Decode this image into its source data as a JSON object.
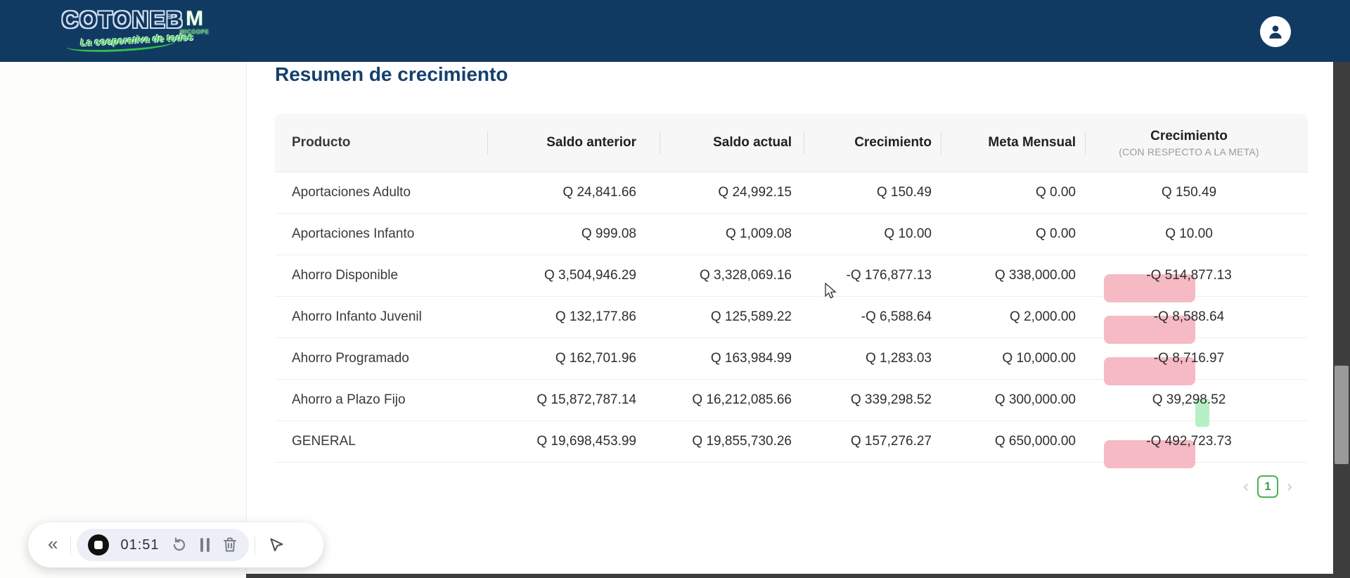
{
  "navbar": {
    "logo": {
      "title": "COTONEB",
      "tagline": "La cooperativa de todos",
      "badge_letter": "M",
      "badge_label": "MICOOPE"
    }
  },
  "page": {
    "title": "Resumen de crecimiento"
  },
  "table": {
    "headers": {
      "producto": "Producto",
      "saldo_anterior": "Saldo anterior",
      "saldo_actual": "Saldo actual",
      "crecimiento": "Crecimiento",
      "meta_mensual": "Meta Mensual",
      "crecimiento_meta": "Crecimiento",
      "crecimiento_meta_sub": "(CON RESPECTO A LA META)"
    },
    "rows": [
      {
        "producto": "Aportaciones Adulto",
        "saldo_anterior": "Q 24,841.66",
        "saldo_actual": "Q 24,992.15",
        "crecimiento": "Q 150.49",
        "meta_mensual": "Q 0.00",
        "crecimiento_meta": "Q 150.49",
        "highlight": "none"
      },
      {
        "producto": "Aportaciones Infanto",
        "saldo_anterior": "Q 999.08",
        "saldo_actual": "Q 1,009.08",
        "crecimiento": "Q 10.00",
        "meta_mensual": "Q 0.00",
        "crecimiento_meta": "Q 10.00",
        "highlight": "none"
      },
      {
        "producto": "Ahorro Disponible",
        "saldo_anterior": "Q 3,504,946.29",
        "saldo_actual": "Q 3,328,069.16",
        "crecimiento": "-Q 176,877.13",
        "meta_mensual": "Q 338,000.00",
        "crecimiento_meta": "-Q 514,877.13",
        "highlight": "negative"
      },
      {
        "producto": "Ahorro Infanto Juvenil",
        "saldo_anterior": "Q 132,177.86",
        "saldo_actual": "Q 125,589.22",
        "crecimiento": "-Q 6,588.64",
        "meta_mensual": "Q 2,000.00",
        "crecimiento_meta": "-Q 8,588.64",
        "highlight": "negative"
      },
      {
        "producto": "Ahorro Programado",
        "saldo_anterior": "Q 162,701.96",
        "saldo_actual": "Q 163,984.99",
        "crecimiento": "Q 1,283.03",
        "meta_mensual": "Q 10,000.00",
        "crecimiento_meta": "-Q 8,716.97",
        "highlight": "negative"
      },
      {
        "producto": "Ahorro a Plazo Fijo",
        "saldo_anterior": "Q 15,872,787.14",
        "saldo_actual": "Q 16,212,085.66",
        "crecimiento": "Q 339,298.52",
        "meta_mensual": "Q 300,000.00",
        "crecimiento_meta": "Q 39,298.52",
        "highlight": "positive"
      },
      {
        "producto": "GENERAL",
        "saldo_anterior": "Q 19,698,453.99",
        "saldo_actual": "Q 19,855,730.26",
        "crecimiento": "Q 157,276.27",
        "meta_mensual": "Q 650,000.00",
        "crecimiento_meta": "-Q 492,723.73",
        "highlight": "negative"
      }
    ]
  },
  "pagination": {
    "prev": "‹",
    "page": "1",
    "next": "›"
  },
  "recorder": {
    "collapse": "«",
    "timer": "01:51",
    "icons": {
      "collapse": "chevrons-left-icon",
      "stop": "stop-record-icon",
      "restart": "restart-icon",
      "pause": "pause-icon",
      "delete": "trash-icon",
      "pointer": "cursor-pointer-icon"
    }
  },
  "colors": {
    "navbar_bg": "#113a62",
    "title_text": "#15406e",
    "negative_highlight": "#f5bac4",
    "positive_highlight": "#b7f0c4",
    "brand_green": "#35c04b",
    "pagination_green": "#43a047"
  }
}
